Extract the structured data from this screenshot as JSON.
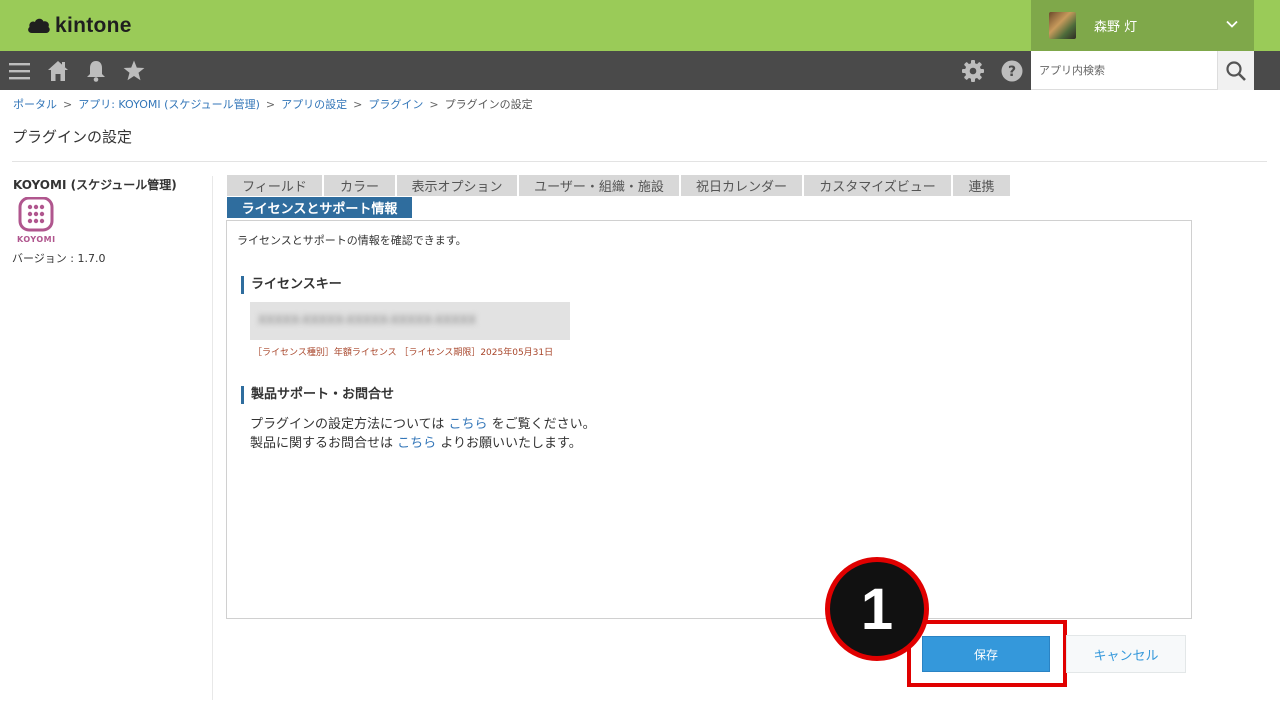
{
  "header": {
    "logo_text": "kintone",
    "user_name": "森野 灯"
  },
  "toolbar": {
    "search_placeholder": "アプリ内検索",
    "icons": [
      "menu-icon",
      "home-icon",
      "bell-icon",
      "star-icon",
      "gear-icon",
      "help-icon",
      "search-icon"
    ]
  },
  "breadcrumb": {
    "items": [
      "ポータル",
      "アプリ: KOYOMI (スケジュール管理)",
      "アプリの設定",
      "プラグイン",
      "プラグインの設定"
    ],
    "separator": ">"
  },
  "page_title": "プラグインの設定",
  "plugin": {
    "name": "KOYOMI (スケジュール管理)",
    "icon_label": "KOYOMI",
    "version": "バージョン : 1.7.0"
  },
  "tabs": [
    {
      "label": "フィールド"
    },
    {
      "label": "カラー"
    },
    {
      "label": "表示オプション"
    },
    {
      "label": "ユーザー・組織・施設"
    },
    {
      "label": "祝日カレンダー"
    },
    {
      "label": "カスタマイズビュー"
    },
    {
      "label": "連携"
    },
    {
      "label": "ライセンスとサポート情報",
      "active": true
    }
  ],
  "panel": {
    "intro": "ライセンスとサポートの情報を確認できます。",
    "license_title": "ライセンスキー",
    "license_key": "XXXXX-XXXXX-XXXXX-XXXXX-XXXXX",
    "license_info": "［ライセンス種別］年額ライセンス ［ライセンス期限］2025年05月31日",
    "support_title": "製品サポート・お問合せ",
    "support_line1_prefix": "プラグインの設定方法については",
    "support_line1_link": "こちら",
    "support_line1_suffix": "をご覧ください。",
    "support_line2_prefix": "製品に関するお問合せは",
    "support_line2_link": "こちら",
    "support_line2_suffix": "よりお願いいたします。"
  },
  "buttons": {
    "save": "保存",
    "cancel": "キャンセル"
  },
  "annotation": {
    "step_number": "1"
  },
  "colors": {
    "header_bg": "#9acb58",
    "toolbar_bg": "#4a4a4a",
    "accent_blue": "#3498db",
    "tab_active": "#2f6d9e",
    "highlight_red": "#e00000"
  }
}
